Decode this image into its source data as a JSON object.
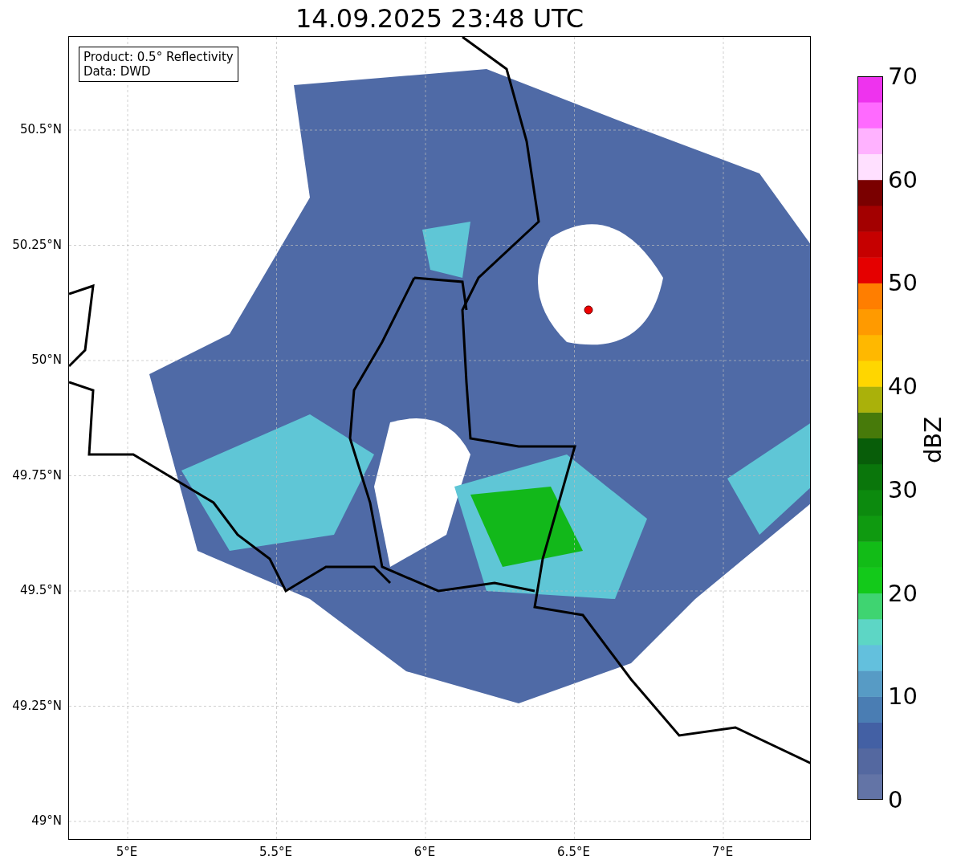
{
  "title": "14.09.2025 23:48 UTC",
  "legend": [
    "Product: 0.5° Reflectivity",
    "Data: DWD"
  ],
  "y_ticks": [
    "50.5°N",
    "50.25°N",
    "50°N",
    "49.75°N",
    "49.5°N",
    "49.25°N",
    "49°N"
  ],
  "x_ticks": [
    "5°E",
    "5.5°E",
    "6°E",
    "6.5°E",
    "7°E"
  ],
  "colorbar": {
    "label": "dBZ",
    "ticks": [
      "70",
      "60",
      "50",
      "40",
      "30",
      "20",
      "10",
      "0"
    ]
  }
}
